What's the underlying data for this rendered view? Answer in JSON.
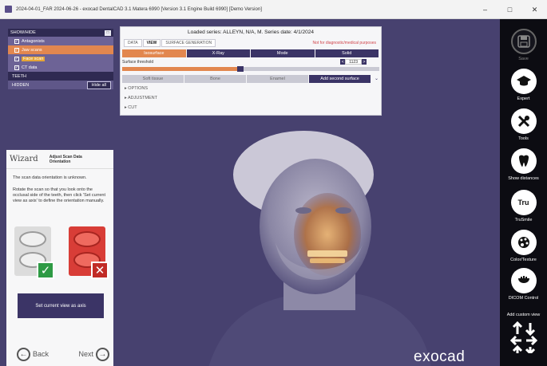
{
  "window": {
    "title": "2024-04-01_FAR 2024-06-26 - exocad DentalCAD 3.1 Matera 6990 [Version 3.1 Engine Build 6990] [Demo Version]",
    "minimize": "–",
    "maximize": "□",
    "close": "✕"
  },
  "tree": {
    "header": "SHOW/HIDE",
    "pin": "□",
    "items": [
      {
        "label": "Antagonists",
        "check": "✓"
      },
      {
        "label": "Jaw scans",
        "check": "✓"
      },
      {
        "label": "Face scan",
        "check": "✓"
      },
      {
        "label": "CT data",
        "check": "✓"
      }
    ],
    "teeth": "TEETH",
    "hidden": "HIDDEN",
    "hide_all": "Hide all"
  },
  "dialog": {
    "title": "Loaded series: ALLEYN, N/A, M. Series date: 4/1/2024",
    "tabs": [
      "DATA",
      "VIEW",
      "SURFACE GENERATION"
    ],
    "warning": "Not for diagnostic/medical purposes",
    "render_modes": [
      "Isosurface",
      "X-Ray",
      "Mode",
      "Solid"
    ],
    "threshold_label": "Surface threshold",
    "threshold_value": "1123",
    "threshold_fraction": 0.46,
    "step_left": "<",
    "step_right": ">",
    "tissues": [
      "Soft tissue",
      "Bone",
      "Enamel",
      "Add second surface"
    ],
    "expand": "⌄",
    "sections": [
      "OPTIONS",
      "ADJUSTMENT",
      "CUT"
    ]
  },
  "wizard": {
    "title": "Wizard",
    "subtitle": "Adjust Scan Data Orientation",
    "para1": "The scan data orientation is unknown.",
    "para2": "Rotate the scan so that you look onto the occlusal side of the teeth, then click 'Set current view as axis' to define the orientation manually.",
    "ok_mark": "✓",
    "no_mark": "✕",
    "set_axis": "Set current view as axis",
    "back": "Back",
    "next": "Next",
    "back_arrow": "←",
    "next_arrow": "→"
  },
  "logo": "exocad",
  "tools": [
    {
      "label": "Save",
      "icon": "save-icon",
      "glyph": "💾",
      "dim": true
    },
    {
      "label": "Expert",
      "icon": "graduation-cap-icon",
      "glyph": "🎓",
      "dim": false
    },
    {
      "label": "Tools",
      "icon": "wrench-icon",
      "glyph": "🔧",
      "dim": false
    },
    {
      "label": "Show distances",
      "icon": "tooth-distance-icon",
      "glyph": "◍",
      "dim": false
    },
    {
      "label": "TruSmile",
      "icon": "trusmile-icon",
      "glyph": "Tru",
      "dim": false
    },
    {
      "label": "Color/Texture",
      "icon": "palette-icon",
      "glyph": "🎨",
      "dim": false
    },
    {
      "label": "DICOM Control",
      "icon": "dicom-icon",
      "glyph": "◉",
      "dim": false
    },
    {
      "label": "Add custom view",
      "icon": "view-arrows-icon",
      "glyph": "⇅",
      "dim": false
    }
  ]
}
